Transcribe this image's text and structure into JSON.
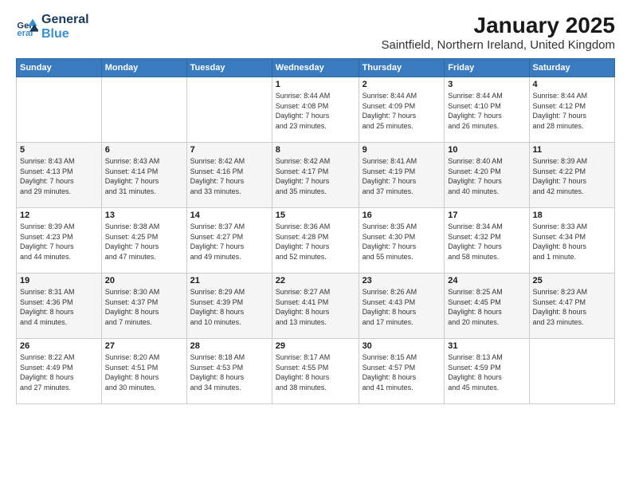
{
  "logo": {
    "line1": "General",
    "line2": "Blue"
  },
  "title": "January 2025",
  "subtitle": "Saintfield, Northern Ireland, United Kingdom",
  "days_header": [
    "Sunday",
    "Monday",
    "Tuesday",
    "Wednesday",
    "Thursday",
    "Friday",
    "Saturday"
  ],
  "weeks": [
    [
      {
        "num": "",
        "info": ""
      },
      {
        "num": "",
        "info": ""
      },
      {
        "num": "",
        "info": ""
      },
      {
        "num": "1",
        "info": "Sunrise: 8:44 AM\nSunset: 4:08 PM\nDaylight: 7 hours\nand 23 minutes."
      },
      {
        "num": "2",
        "info": "Sunrise: 8:44 AM\nSunset: 4:09 PM\nDaylight: 7 hours\nand 25 minutes."
      },
      {
        "num": "3",
        "info": "Sunrise: 8:44 AM\nSunset: 4:10 PM\nDaylight: 7 hours\nand 26 minutes."
      },
      {
        "num": "4",
        "info": "Sunrise: 8:44 AM\nSunset: 4:12 PM\nDaylight: 7 hours\nand 28 minutes."
      }
    ],
    [
      {
        "num": "5",
        "info": "Sunrise: 8:43 AM\nSunset: 4:13 PM\nDaylight: 7 hours\nand 29 minutes."
      },
      {
        "num": "6",
        "info": "Sunrise: 8:43 AM\nSunset: 4:14 PM\nDaylight: 7 hours\nand 31 minutes."
      },
      {
        "num": "7",
        "info": "Sunrise: 8:42 AM\nSunset: 4:16 PM\nDaylight: 7 hours\nand 33 minutes."
      },
      {
        "num": "8",
        "info": "Sunrise: 8:42 AM\nSunset: 4:17 PM\nDaylight: 7 hours\nand 35 minutes."
      },
      {
        "num": "9",
        "info": "Sunrise: 8:41 AM\nSunset: 4:19 PM\nDaylight: 7 hours\nand 37 minutes."
      },
      {
        "num": "10",
        "info": "Sunrise: 8:40 AM\nSunset: 4:20 PM\nDaylight: 7 hours\nand 40 minutes."
      },
      {
        "num": "11",
        "info": "Sunrise: 8:39 AM\nSunset: 4:22 PM\nDaylight: 7 hours\nand 42 minutes."
      }
    ],
    [
      {
        "num": "12",
        "info": "Sunrise: 8:39 AM\nSunset: 4:23 PM\nDaylight: 7 hours\nand 44 minutes."
      },
      {
        "num": "13",
        "info": "Sunrise: 8:38 AM\nSunset: 4:25 PM\nDaylight: 7 hours\nand 47 minutes."
      },
      {
        "num": "14",
        "info": "Sunrise: 8:37 AM\nSunset: 4:27 PM\nDaylight: 7 hours\nand 49 minutes."
      },
      {
        "num": "15",
        "info": "Sunrise: 8:36 AM\nSunset: 4:28 PM\nDaylight: 7 hours\nand 52 minutes."
      },
      {
        "num": "16",
        "info": "Sunrise: 8:35 AM\nSunset: 4:30 PM\nDaylight: 7 hours\nand 55 minutes."
      },
      {
        "num": "17",
        "info": "Sunrise: 8:34 AM\nSunset: 4:32 PM\nDaylight: 7 hours\nand 58 minutes."
      },
      {
        "num": "18",
        "info": "Sunrise: 8:33 AM\nSunset: 4:34 PM\nDaylight: 8 hours\nand 1 minute."
      }
    ],
    [
      {
        "num": "19",
        "info": "Sunrise: 8:31 AM\nSunset: 4:36 PM\nDaylight: 8 hours\nand 4 minutes."
      },
      {
        "num": "20",
        "info": "Sunrise: 8:30 AM\nSunset: 4:37 PM\nDaylight: 8 hours\nand 7 minutes."
      },
      {
        "num": "21",
        "info": "Sunrise: 8:29 AM\nSunset: 4:39 PM\nDaylight: 8 hours\nand 10 minutes."
      },
      {
        "num": "22",
        "info": "Sunrise: 8:27 AM\nSunset: 4:41 PM\nDaylight: 8 hours\nand 13 minutes."
      },
      {
        "num": "23",
        "info": "Sunrise: 8:26 AM\nSunset: 4:43 PM\nDaylight: 8 hours\nand 17 minutes."
      },
      {
        "num": "24",
        "info": "Sunrise: 8:25 AM\nSunset: 4:45 PM\nDaylight: 8 hours\nand 20 minutes."
      },
      {
        "num": "25",
        "info": "Sunrise: 8:23 AM\nSunset: 4:47 PM\nDaylight: 8 hours\nand 23 minutes."
      }
    ],
    [
      {
        "num": "26",
        "info": "Sunrise: 8:22 AM\nSunset: 4:49 PM\nDaylight: 8 hours\nand 27 minutes."
      },
      {
        "num": "27",
        "info": "Sunrise: 8:20 AM\nSunset: 4:51 PM\nDaylight: 8 hours\nand 30 minutes."
      },
      {
        "num": "28",
        "info": "Sunrise: 8:18 AM\nSunset: 4:53 PM\nDaylight: 8 hours\nand 34 minutes."
      },
      {
        "num": "29",
        "info": "Sunrise: 8:17 AM\nSunset: 4:55 PM\nDaylight: 8 hours\nand 38 minutes."
      },
      {
        "num": "30",
        "info": "Sunrise: 8:15 AM\nSunset: 4:57 PM\nDaylight: 8 hours\nand 41 minutes."
      },
      {
        "num": "31",
        "info": "Sunrise: 8:13 AM\nSunset: 4:59 PM\nDaylight: 8 hours\nand 45 minutes."
      },
      {
        "num": "",
        "info": ""
      }
    ]
  ]
}
